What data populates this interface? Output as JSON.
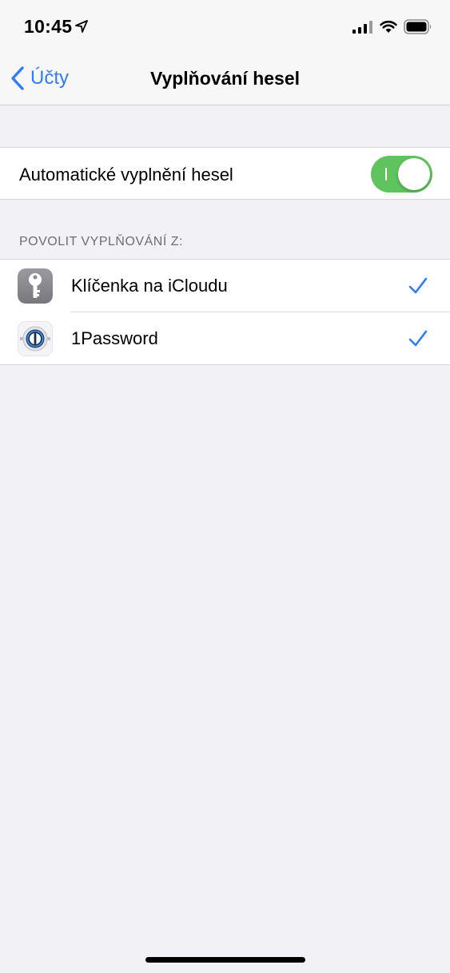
{
  "status_bar": {
    "time": "10:45",
    "icons": [
      "location-arrow-icon",
      "cellular-signal-icon",
      "wifi-icon",
      "battery-icon"
    ]
  },
  "nav": {
    "back_label": "Účty",
    "title": "Vyplňování hesel"
  },
  "autofill": {
    "label": "Automatické vyplnění hesel",
    "enabled": true
  },
  "providers_section": {
    "header": "POVOLIT VYPLŇOVÁNÍ Z:",
    "items": [
      {
        "label": "Klíčenka na iCloudu",
        "icon": "keychain-key-icon",
        "checked": true
      },
      {
        "label": "1Password",
        "icon": "onepassword-icon",
        "checked": true
      }
    ]
  },
  "colors": {
    "accent": "#2f7cf6",
    "toggle_on": "#5fc45e",
    "background": "#f1f1f6"
  }
}
